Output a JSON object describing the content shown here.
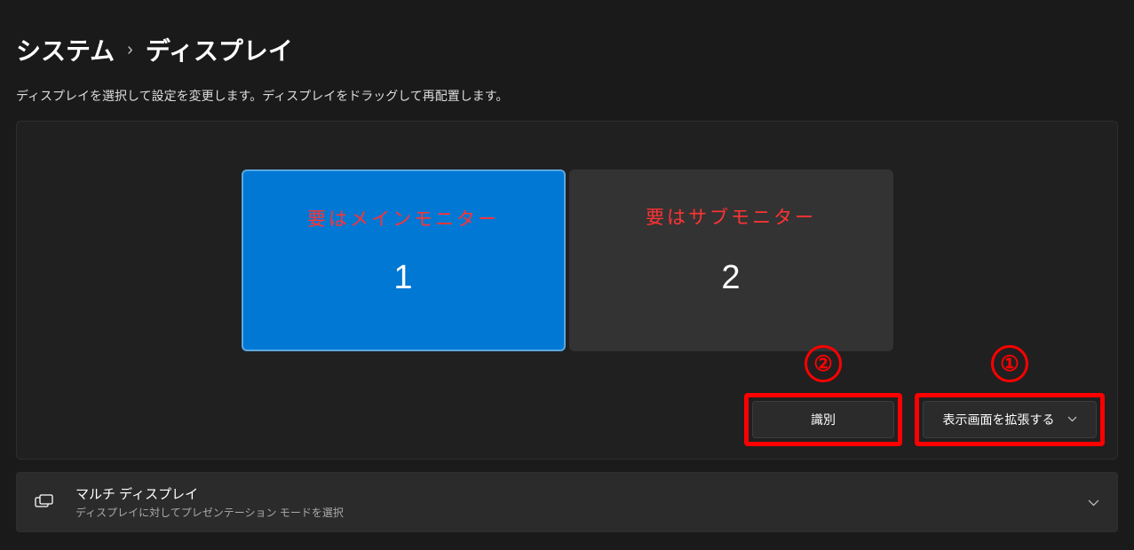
{
  "breadcrumb": {
    "parent": "システム",
    "current": "ディスプレイ"
  },
  "description": "ディスプレイを選択して設定を変更します。ディスプレイをドラッグして再配置します。",
  "monitors": [
    {
      "annotation": "要はメインモニター",
      "number": "1"
    },
    {
      "annotation": "要はサブモニター",
      "number": "2"
    }
  ],
  "annotations": {
    "circle_identify": "②",
    "circle_dropdown": "①"
  },
  "buttons": {
    "identify": "識別",
    "dropdown_selected": "表示画面を拡張する"
  },
  "multi_display": {
    "title": "マルチ ディスプレイ",
    "subtitle": "ディスプレイに対してプレゼンテーション モードを選択"
  }
}
